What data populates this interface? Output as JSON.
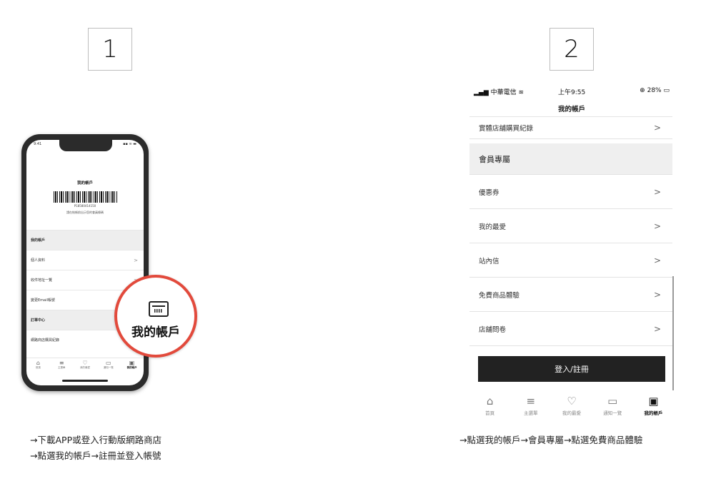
{
  "steps": {
    "one": "1",
    "two": "2"
  },
  "captions": {
    "step1_line1": "→下載APP或登入行動版網路商店",
    "step1_line2": "→點選我的帳戶→註冊並登入帳號",
    "step2_line1": "→點選我的帳戶→會員專屬→點選免費商品體驗"
  },
  "phone1": {
    "title": "我的帳戶",
    "barcode_number": "P18580414150",
    "barcode_hint": "請在結帳前出示您的會員條碼",
    "rows": [
      {
        "label": "我的帳戶",
        "section": true
      },
      {
        "label": "個人資料",
        "chevron": ">"
      },
      {
        "label": "收件地址一覽",
        "chevron": ">"
      },
      {
        "label": "變更Email帳號",
        "chevron": ""
      },
      {
        "label": "訂單中心",
        "section": true
      },
      {
        "label": "網路商店購買紀錄",
        "chevron": ""
      }
    ],
    "tabs": [
      "首頁",
      "主選單",
      "我的最愛",
      "通知一覽",
      "我的帳戶"
    ],
    "magnifier_label": "我的帳戶"
  },
  "phone2": {
    "status": {
      "carrier": "中華電信",
      "time": "上午9:55",
      "battery": "28%"
    },
    "title": "我的帳戶",
    "rows": [
      {
        "label": "實體店舖購買紀錄",
        "chevron": ">"
      },
      {
        "label": "會員專屬",
        "section": true
      },
      {
        "label": "優惠券",
        "chevron": ">"
      },
      {
        "label": "我的最愛",
        "chevron": ">"
      },
      {
        "label": "站內信",
        "chevron": ">"
      },
      {
        "label": "免費商品體驗",
        "chevron": ">"
      },
      {
        "label": "店舖問卷",
        "chevron": ">"
      }
    ],
    "login_button": "登入/註冊",
    "tabs": [
      {
        "label": "首頁",
        "icon": "home-icon"
      },
      {
        "label": "主選單",
        "icon": "menu-icon"
      },
      {
        "label": "我的最愛",
        "icon": "heart-icon"
      },
      {
        "label": "通知一覽",
        "icon": "chat-icon"
      },
      {
        "label": "我的帳戶",
        "icon": "account-card-icon"
      }
    ],
    "accent_color": "#222222"
  }
}
